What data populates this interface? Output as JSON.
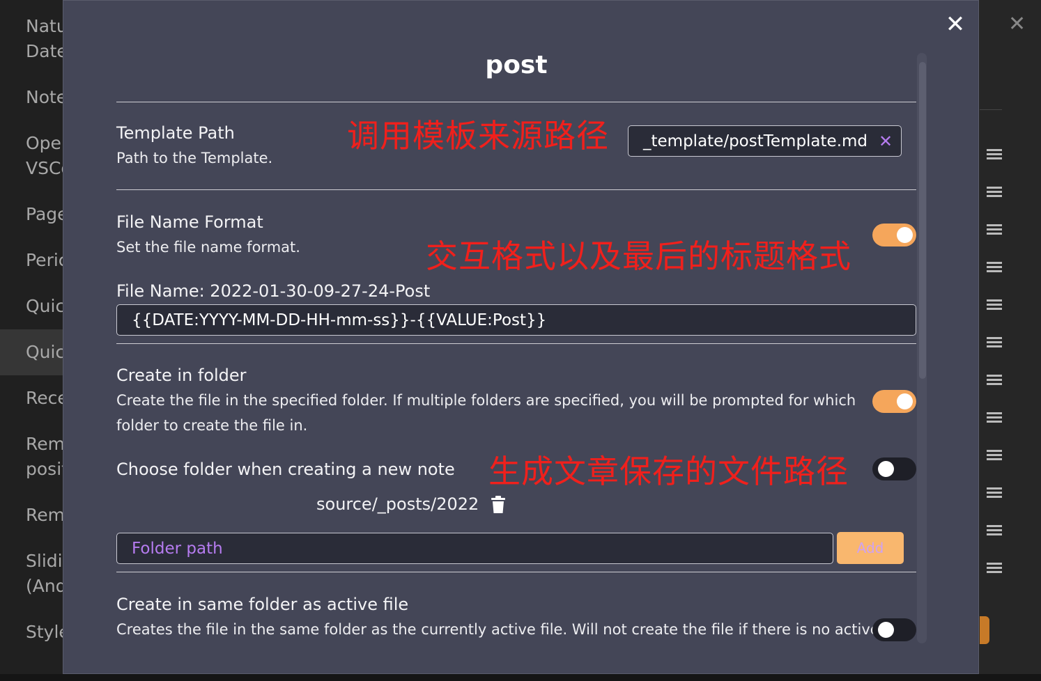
{
  "background": {
    "sidebar_items": [
      "Natu",
      "Date",
      "Note",
      "Oper",
      "VSCo",
      "Page",
      "Peric",
      "Quic",
      "Quic",
      "Rece",
      "Rem",
      "posit",
      "Rem",
      "Slidi",
      "(And",
      "Style"
    ],
    "close_icon": "close-icon",
    "drag_handle_icon": "drag-handle-icon"
  },
  "modal": {
    "title": "post",
    "close_icon": "close-icon",
    "template_path": {
      "name": "Template Path",
      "desc": "Path to the Template.",
      "value": "_template/postTemplate.md",
      "clear_icon": "close-icon",
      "annotation": "调用模板来源路径"
    },
    "file_name_format": {
      "name": "File Name Format",
      "desc": "Set the file name format.",
      "enabled": true,
      "annotation": "交互格式以及最后的标题格式",
      "preview_label": "File Name: 2022-01-30-09-27-24-Post",
      "value": "{{DATE:YYYY-MM-DD-HH-mm-ss}}-{{VALUE:Post}}"
    },
    "create_in_folder": {
      "name": "Create in folder",
      "desc_line1": "Create the file in the specified folder. If multiple folders are specified, you will be prompted for which",
      "desc_line2": "folder to create the file in.",
      "enabled": true
    },
    "choose_folder": {
      "name": "Choose folder when creating a new note",
      "enabled": false,
      "annotation": "生成文章保存的文件路径"
    },
    "folder": {
      "value": "source/_posts/2022",
      "delete_icon": "trash-icon",
      "input_placeholder": "Folder path",
      "add_label": "Add"
    },
    "same_folder": {
      "name": "Create in same folder as active file",
      "desc": "Creates the file in the same folder as the currently active file. Will not create the file if there is no active",
      "enabled": false
    }
  },
  "colors": {
    "accent_orange": "#f5a65b",
    "accent_purple": "#b67cf0",
    "annotation_red": "#f0201c",
    "modal_bg": "#444657"
  }
}
